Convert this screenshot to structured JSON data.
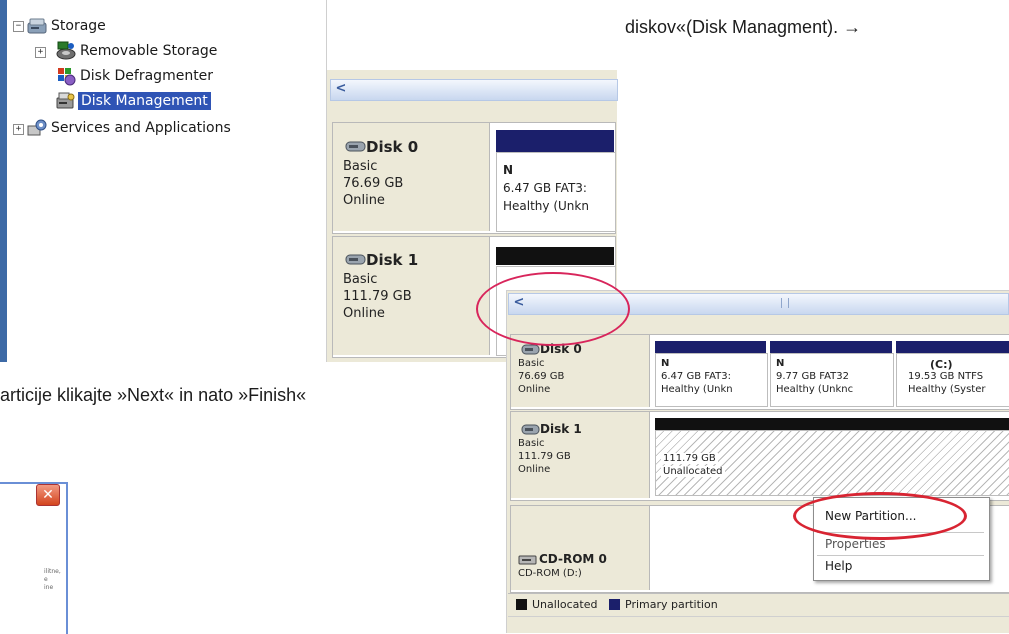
{
  "doc": {
    "top_right_text": "diskov«(Disk Managment). →",
    "left_text": "articije klikajte »Next« in nato »Finish«"
  },
  "tree": {
    "items": [
      {
        "label": "Storage",
        "icon": "storage-icon"
      },
      {
        "label": "Removable Storage",
        "icon": "removable-storage-icon"
      },
      {
        "label": "Disk Defragmenter",
        "icon": "defragmenter-icon"
      },
      {
        "label": "Disk Management",
        "icon": "disk-management-icon",
        "selected": true
      },
      {
        "label": "Services and Applications",
        "icon": "services-icon"
      }
    ],
    "expander_collapsed": "+",
    "expander_expanded": "−"
  },
  "window1": {
    "scroll_left": "<",
    "disks": [
      {
        "name": "Disk 0",
        "type": "Basic",
        "size": "76.69 GB",
        "status": "Online",
        "partition": {
          "letter": "N",
          "size_fs": "6.47 GB FAT3:",
          "health": "Healthy (Unkn"
        }
      },
      {
        "name": "Disk 1",
        "type": "Basic",
        "size": "111.79 GB",
        "status": "Online"
      }
    ]
  },
  "window2": {
    "scroll_left": "<",
    "disks": [
      {
        "name": "Disk 0",
        "type": "Basic",
        "size": "76.69 GB",
        "status": "Online",
        "partitions": [
          {
            "letter": "N",
            "size_fs": "6.47 GB FAT3:",
            "health": "Healthy (Unkn"
          },
          {
            "letter": "N",
            "size_fs": "9.77 GB FAT32",
            "health": "Healthy (Unknc"
          },
          {
            "letter": "(C:)",
            "size_fs": "19.53 GB NTFS",
            "health": "Healthy (Syster"
          }
        ]
      },
      {
        "name": "Disk 1",
        "type": "Basic",
        "size": "111.79 GB",
        "status": "Online",
        "unallocated": {
          "size": "111.79 GB",
          "label": "Unallocated"
        }
      },
      {
        "name": "CD-ROM 0",
        "type": "CD-ROM (D:)"
      }
    ],
    "context_menu": [
      "New Partition...",
      "Properties",
      "Help"
    ],
    "legend": [
      {
        "label": "Unallocated",
        "color": "#111111"
      },
      {
        "label": "Primary partition",
        "color": "#1b1f6b"
      }
    ]
  },
  "dialog": {
    "close": "✕",
    "blurred_lines": [
      "ilitne,",
      "e",
      "ine"
    ]
  },
  "colors": {
    "highlight_ellipse": "#d8255b",
    "selection": "#2f54b5",
    "window_bg": "#ece9d8",
    "primary_bar": "#1b1f6b"
  }
}
